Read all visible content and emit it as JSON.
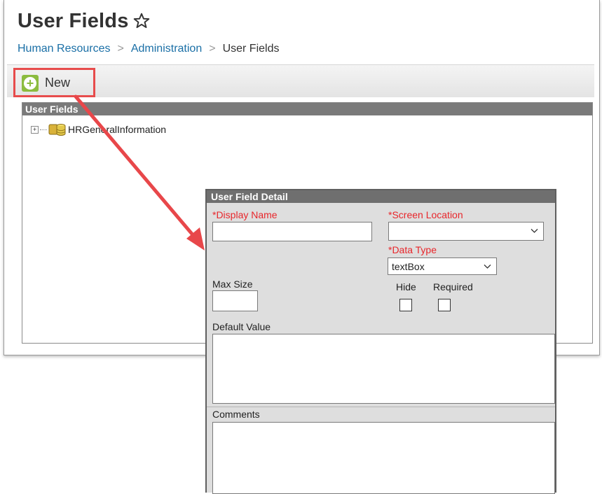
{
  "header": {
    "title": "User Fields",
    "breadcrumb": [
      {
        "label": "Human Resources"
      },
      {
        "label": "Administration"
      },
      {
        "label": "User Fields"
      }
    ],
    "breadcrumb_separator": ">"
  },
  "toolbar": {
    "new_label": "New"
  },
  "tree": {
    "header": "User Fields",
    "items": [
      {
        "label": "HRGeneralInformation",
        "icon": "database-folder-icon"
      }
    ]
  },
  "detail": {
    "header": "User Field Detail",
    "display_name_label": "*Display Name",
    "display_name_value": "",
    "screen_location_label": "*Screen Location",
    "screen_location_value": "",
    "data_type_label": "*Data Type",
    "data_type_value": "textBox",
    "max_size_label": "Max Size",
    "max_size_value": "",
    "hide_label": "Hide",
    "required_label": "Required",
    "default_value_label": "Default Value",
    "comments_label": "Comments"
  },
  "colors": {
    "link": "#1a6fa6",
    "required": "#e8262b",
    "highlight": "#e74c4c",
    "new_icon": "#8cbc3f"
  }
}
